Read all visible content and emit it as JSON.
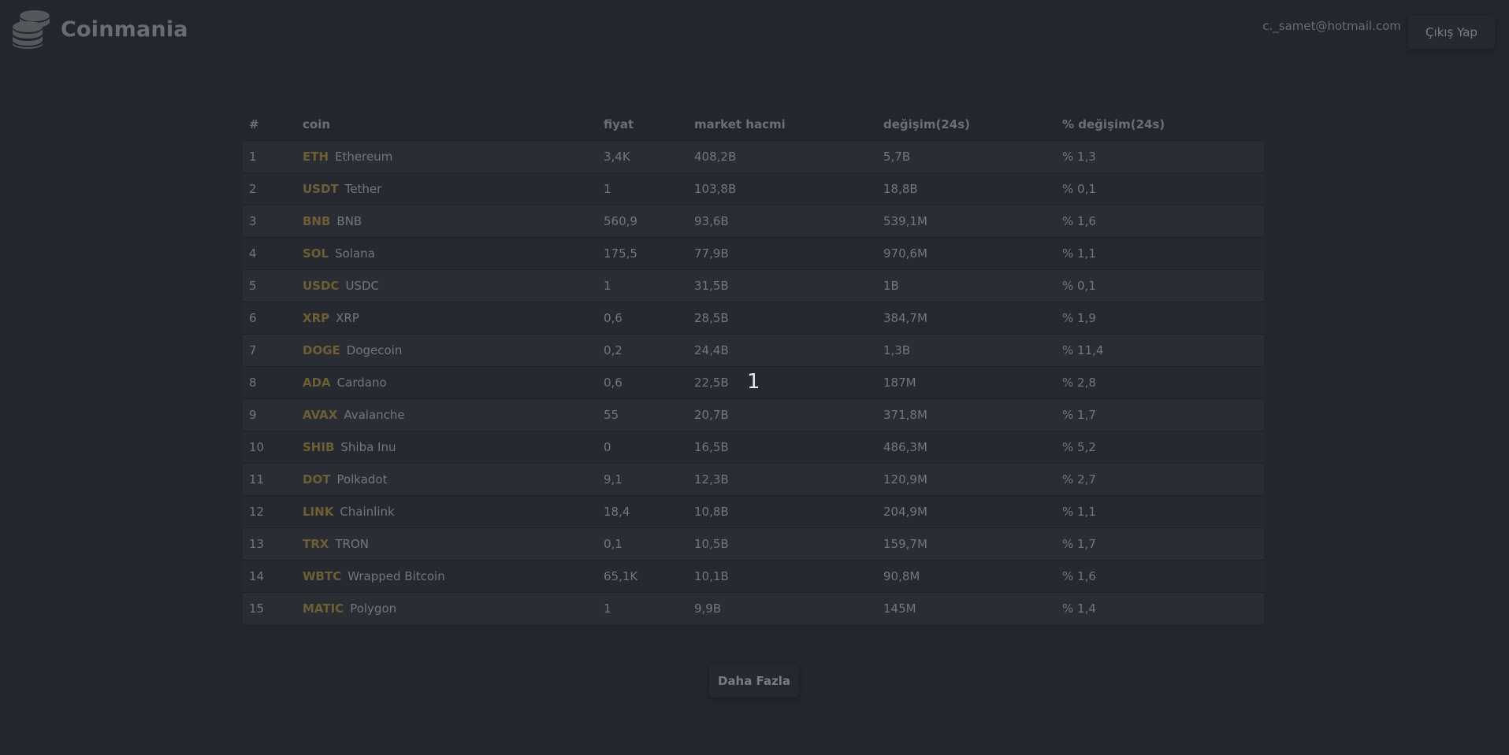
{
  "header": {
    "brand_name": "Coinmania",
    "brand_icon": "coin-stack-icon",
    "user_email": "c._samet@hotmail.com",
    "logout_label": "Çıkış Yap"
  },
  "table": {
    "columns": {
      "rank": "#",
      "coin": "coin",
      "price": "fiyat",
      "market_cap": "market hacmi",
      "change_24h": "değişim(24s)",
      "pct_change_24h": "% değişim(24s)"
    },
    "rows": [
      {
        "rank": "1",
        "symbol": "ETH",
        "name": "Ethereum",
        "price": "3,4K",
        "market_cap": "408,2B",
        "change": "5,7B",
        "pct": "% 1,3"
      },
      {
        "rank": "2",
        "symbol": "USDT",
        "name": "Tether",
        "price": "1",
        "market_cap": "103,8B",
        "change": "18,8B",
        "pct": "% 0,1"
      },
      {
        "rank": "3",
        "symbol": "BNB",
        "name": "BNB",
        "price": "560,9",
        "market_cap": "93,6B",
        "change": "539,1M",
        "pct": "% 1,6"
      },
      {
        "rank": "4",
        "symbol": "SOL",
        "name": "Solana",
        "price": "175,5",
        "market_cap": "77,9B",
        "change": "970,6M",
        "pct": "% 1,1"
      },
      {
        "rank": "5",
        "symbol": "USDC",
        "name": "USDC",
        "price": "1",
        "market_cap": "31,5B",
        "change": "1B",
        "pct": "% 0,1"
      },
      {
        "rank": "6",
        "symbol": "XRP",
        "name": "XRP",
        "price": "0,6",
        "market_cap": "28,5B",
        "change": "384,7M",
        "pct": "% 1,9"
      },
      {
        "rank": "7",
        "symbol": "DOGE",
        "name": "Dogecoin",
        "price": "0,2",
        "market_cap": "24,4B",
        "change": "1,3B",
        "pct": "% 11,4"
      },
      {
        "rank": "8",
        "symbol": "ADA",
        "name": "Cardano",
        "price": "0,6",
        "market_cap": "22,5B",
        "change": "187M",
        "pct": "% 2,8"
      },
      {
        "rank": "9",
        "symbol": "AVAX",
        "name": "Avalanche",
        "price": "55",
        "market_cap": "20,7B",
        "change": "371,8M",
        "pct": "% 1,7"
      },
      {
        "rank": "10",
        "symbol": "SHIB",
        "name": "Shiba Inu",
        "price": "0",
        "market_cap": "16,5B",
        "change": "486,3M",
        "pct": "% 5,2"
      },
      {
        "rank": "11",
        "symbol": "DOT",
        "name": "Polkadot",
        "price": "9,1",
        "market_cap": "12,3B",
        "change": "120,9M",
        "pct": "% 2,7"
      },
      {
        "rank": "12",
        "symbol": "LINK",
        "name": "Chainlink",
        "price": "18,4",
        "market_cap": "10,8B",
        "change": "204,9M",
        "pct": "% 1,1"
      },
      {
        "rank": "13",
        "symbol": "TRX",
        "name": "TRON",
        "price": "0,1",
        "market_cap": "10,5B",
        "change": "159,7M",
        "pct": "% 1,7"
      },
      {
        "rank": "14",
        "symbol": "WBTC",
        "name": "Wrapped Bitcoin",
        "price": "65,1K",
        "market_cap": "10,1B",
        "change": "90,8M",
        "pct": "% 1,6"
      },
      {
        "rank": "15",
        "symbol": "MATIC",
        "name": "Polygon",
        "price": "1",
        "market_cap": "9,9B",
        "change": "145M",
        "pct": "% 1,4"
      }
    ]
  },
  "overlay_text": "1",
  "more_button_label": "Daha Fazla",
  "colors": {
    "background": "#23262d",
    "symbol_accent": "#6d5e35"
  }
}
